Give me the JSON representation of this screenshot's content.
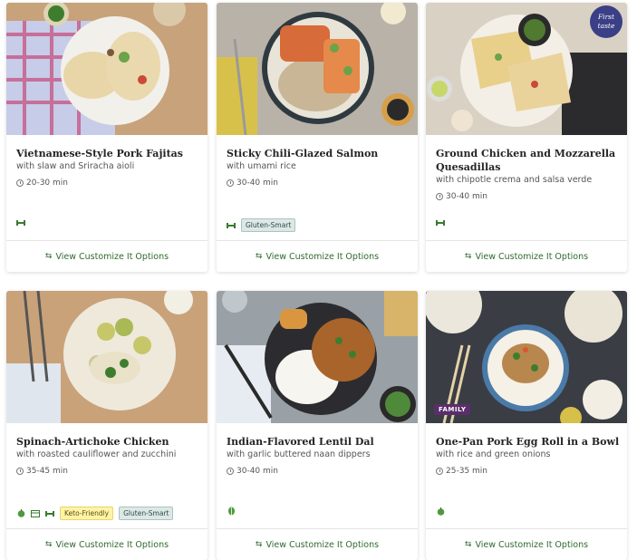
{
  "cta_label": "View Customize It Options",
  "cards": [
    {
      "title": "Vietnamese-Style Pork Fajitas",
      "subtitle": "with slaw and Sriracha aioli",
      "time": "20-30 min",
      "badges": []
    },
    {
      "title": "Sticky Chili-Glazed Salmon",
      "subtitle": "with umami rice",
      "time": "30-40 min",
      "badges": [
        "Gluten-Smart"
      ]
    },
    {
      "title": "Ground Chicken and Mozzarella Quesadillas",
      "subtitle": "with chipotle crema and salsa verde",
      "time": "30-40 min",
      "badges": [],
      "first_taste": [
        "First",
        "taste"
      ]
    },
    {
      "title": "Spinach-Artichoke Chicken",
      "subtitle": "with roasted cauliflower and zucchini",
      "time": "35-45 min",
      "badges": [
        "Keto-Friendly",
        "Gluten-Smart"
      ]
    },
    {
      "title": "Indian-Flavored Lentil Dal",
      "subtitle": "with garlic buttered naan dippers",
      "time": "30-40 min",
      "badges": []
    },
    {
      "title": "One-Pan Pork Egg Roll in a Bowl",
      "subtitle": "with rice and green onions",
      "time": "25-35 min",
      "badges": [],
      "flag": "FAMILY"
    }
  ],
  "colors": {
    "accent_green": "#2f6b2a",
    "gluten_badge_bg": "#dde8e6",
    "keto_badge_bg": "#fff4a6",
    "family_flag": "#5b2e6b",
    "first_taste": "#3a3f86"
  },
  "icons": {
    "protein": "dumbbell-icon",
    "calorie": "apple-icon",
    "meal_prep": "container-icon",
    "vegetarian": "leaf-icon",
    "customize": "swap-arrows-icon",
    "time": "clock-icon"
  }
}
